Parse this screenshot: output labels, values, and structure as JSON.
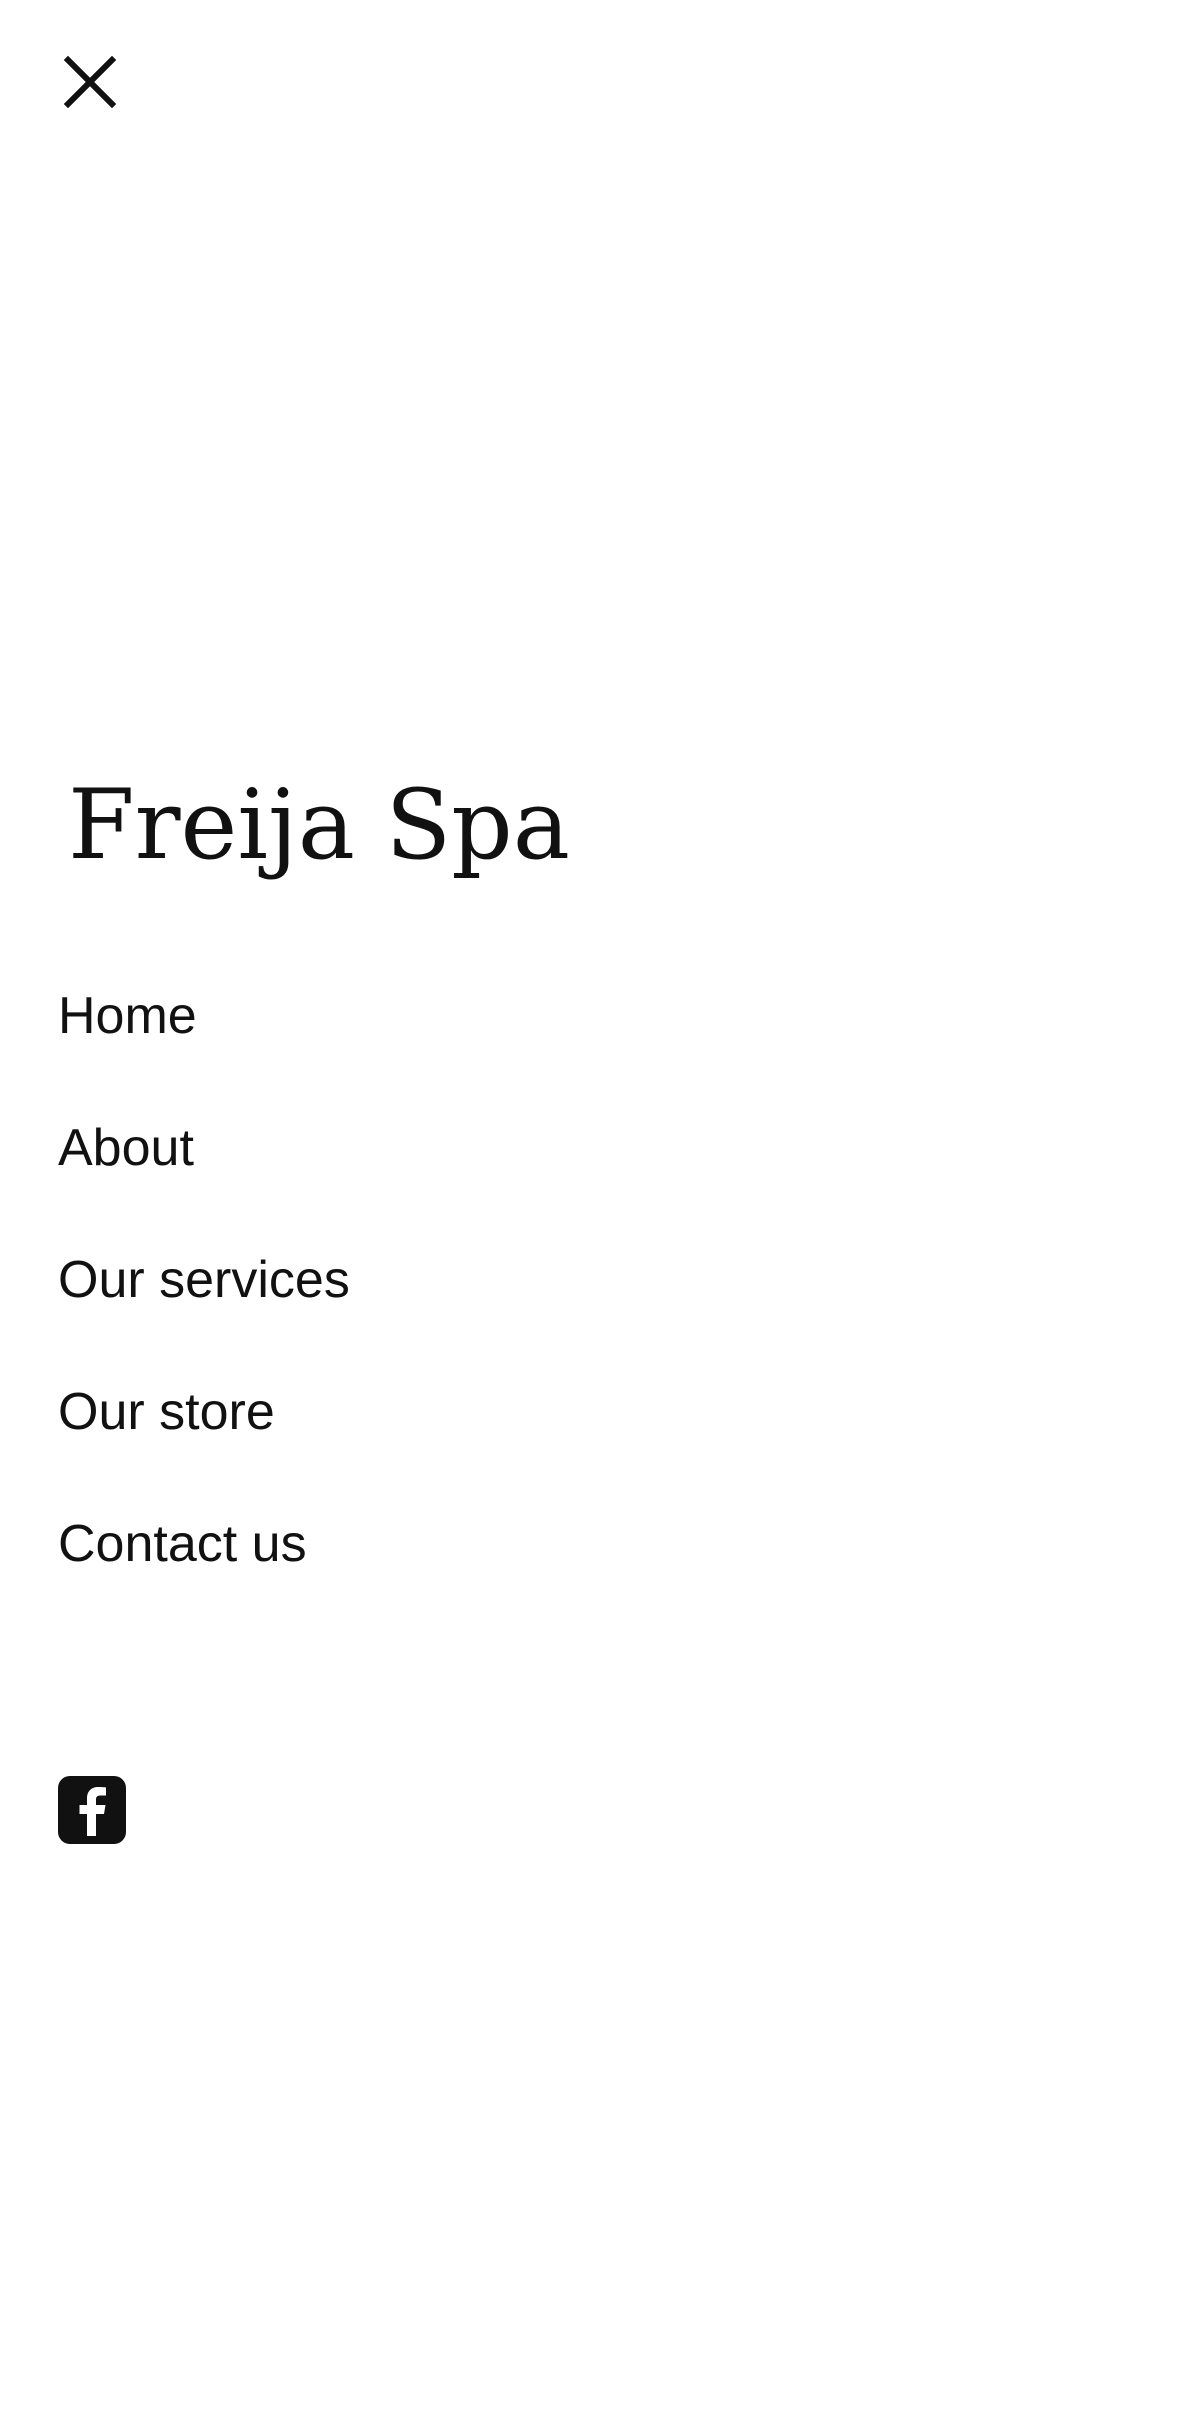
{
  "header": {
    "close_icon": "close-icon"
  },
  "brand": {
    "name": "Freija Spa"
  },
  "nav": {
    "items": [
      {
        "label": "Home"
      },
      {
        "label": "About"
      },
      {
        "label": "Our services"
      },
      {
        "label": "Our store"
      },
      {
        "label": "Contact us"
      }
    ]
  },
  "social": {
    "facebook_icon": "facebook-icon"
  },
  "colors": {
    "background": "#ffffff",
    "text": "#111111"
  }
}
